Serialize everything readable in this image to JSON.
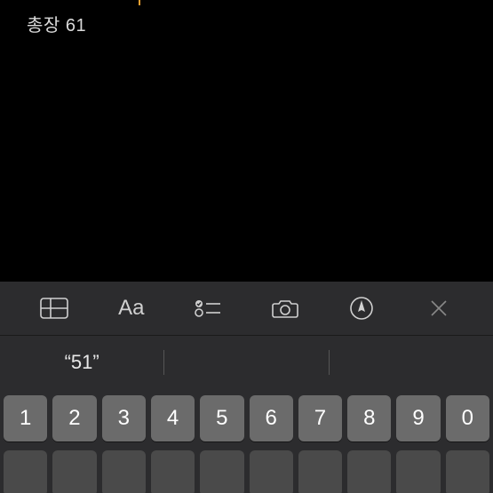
{
  "note": {
    "line1": "총장 61"
  },
  "toolbar": {
    "table": "table-icon",
    "format": "Aa",
    "checklist": "checklist-icon",
    "camera": "camera-icon",
    "markup": "markup-icon",
    "close": "close-icon"
  },
  "suggestions": {
    "s1": "“51”",
    "s2": "",
    "s3": ""
  },
  "keyboard": {
    "row1": [
      "1",
      "2",
      "3",
      "4",
      "5",
      "6",
      "7",
      "8",
      "9",
      "0"
    ]
  }
}
